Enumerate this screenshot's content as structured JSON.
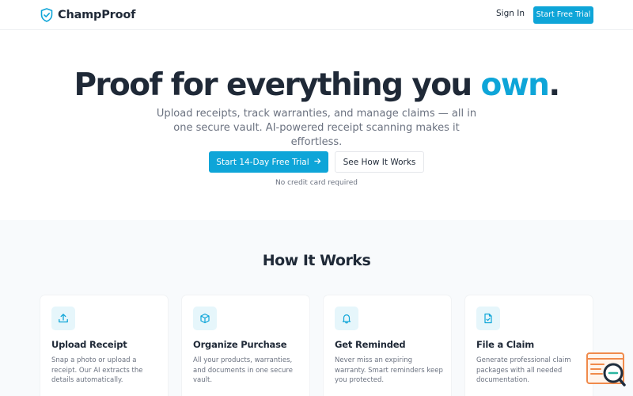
{
  "header": {
    "brand": "ChampProof",
    "sign_in": "Sign In",
    "trial_button": "Start Free Trial"
  },
  "hero": {
    "title_main": "Proof for everything you ",
    "title_accent": "own",
    "title_end": ".",
    "subtitle": "Upload receipts, track warranties, and manage claims — all in one secure vault. AI-powered receipt scanning makes it effortless.",
    "primary_cta": "Start 14-Day Free Trial",
    "secondary_cta": "See How It Works",
    "note": "No credit card required"
  },
  "how_it_works": {
    "title": "How It Works",
    "cards": [
      {
        "icon": "upload-icon",
        "title": "Upload Receipt",
        "desc": "Snap a photo or upload a receipt. Our AI extracts the details automatically."
      },
      {
        "icon": "box-icon",
        "title": "Organize Purchase",
        "desc": "All your products, warranties, and documents in one secure vault."
      },
      {
        "icon": "bell-icon",
        "title": "Get Reminded",
        "desc": "Never miss an expiring warranty. Smart reminders keep you protected."
      },
      {
        "icon": "document-check-icon",
        "title": "File a Claim",
        "desc": "Generate professional claim packages with all needed documentation."
      }
    ]
  },
  "colors": {
    "accent": "#0ea5d8",
    "text": "#1f2937",
    "muted": "#6b7280",
    "section_bg": "#f8fafc",
    "icon_bg": "#e6f6fb",
    "widget": "#f08a4b"
  }
}
